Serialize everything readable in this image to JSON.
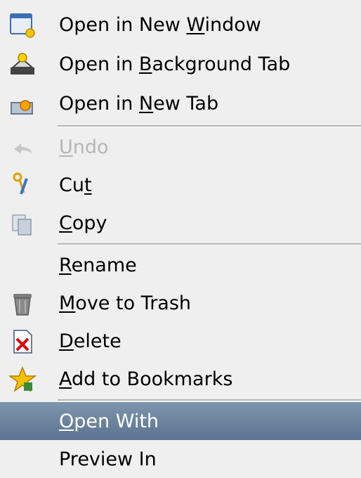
{
  "menu": {
    "items": [
      {
        "pre": "Open in New ",
        "key": "W",
        "post": "indow",
        "icon": "new-window-icon"
      },
      {
        "pre": "Open in ",
        "key": "B",
        "post": "ackground Tab",
        "icon": "background-tab-icon"
      },
      {
        "pre": "Open in ",
        "key": "N",
        "post": "ew Tab",
        "icon": "new-tab-icon"
      },
      {
        "pre": "",
        "key": "U",
        "post": "ndo",
        "icon": "undo-icon",
        "disabled": true
      },
      {
        "pre": "Cu",
        "key": "t",
        "post": "",
        "icon": "cut-icon"
      },
      {
        "pre": "",
        "key": "C",
        "post": "opy",
        "icon": "copy-icon"
      },
      {
        "pre": "",
        "key": "R",
        "post": "ename",
        "icon": ""
      },
      {
        "pre": "",
        "key": "M",
        "post": "ove to Trash",
        "icon": "trash-icon"
      },
      {
        "pre": "",
        "key": "D",
        "post": "elete",
        "icon": "delete-icon"
      },
      {
        "pre": "",
        "key": "A",
        "post": "dd to Bookmarks",
        "icon": "bookmark-icon"
      },
      {
        "pre": "",
        "key": "O",
        "post": "pen With",
        "icon": "",
        "highlighted": true
      },
      {
        "pre": "Preview In",
        "key": "",
        "post": "",
        "icon": ""
      }
    ]
  },
  "colors": {
    "background": "#efefef",
    "highlight": "#6a819c",
    "disabled_text": "#b6b6b6"
  }
}
